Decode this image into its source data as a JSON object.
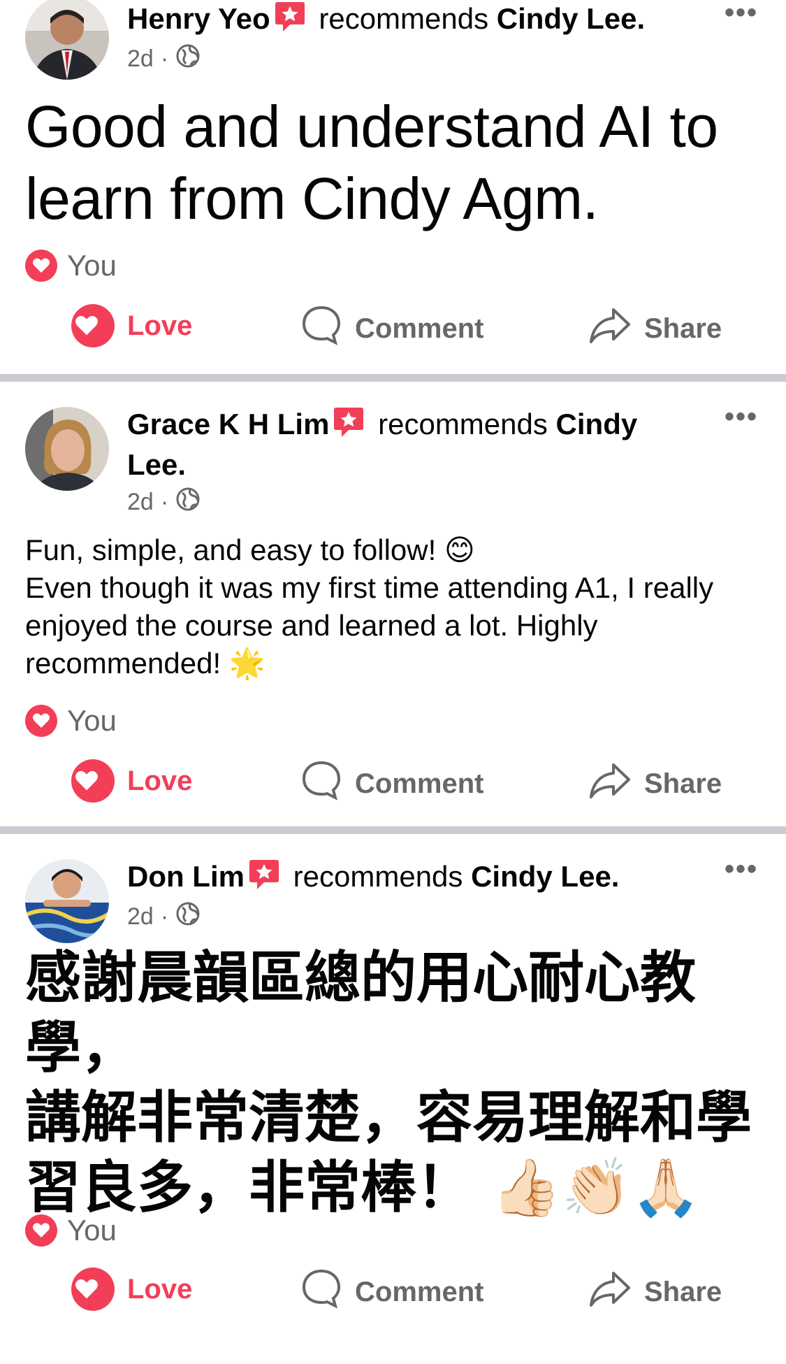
{
  "posts": [
    {
      "author": "Henry Yeo",
      "recommends": "recommends",
      "target": "Cindy Lee.",
      "time": "2d",
      "text": "Good and understand AI to learn from Cindy Agm.",
      "reaction_name": "You",
      "actions": {
        "love": "Love",
        "comment": "Comment",
        "share": "Share"
      }
    },
    {
      "author": "Grace K H Lim",
      "recommends": "recommends",
      "target": "Cindy",
      "target2": "Lee.",
      "time": "2d",
      "text_line1": "Fun, simple, and easy to follow! 😊",
      "text_line2": "Even though it was my first time attending A1, I really enjoyed the course and learned a lot. Highly recommended! 🌟",
      "reaction_name": "You",
      "actions": {
        "love": "Love",
        "comment": "Comment",
        "share": "Share"
      }
    },
    {
      "author": "Don Lim",
      "recommends": "recommends",
      "target": "Cindy Lee.",
      "time": "2d",
      "text_line1": "感謝晨韻區總的用心耐心教學，",
      "text_line2": "講解非常清楚，容易理解和學習良多，非常棒！ 👍🏻👏🏻🙏🏻",
      "reaction_name": "You",
      "actions": {
        "love": "Love",
        "comment": "Comment",
        "share": "Share"
      }
    }
  ],
  "colors": {
    "love": "#f33e58",
    "secondary": "#65676b",
    "divider": "#c9ccd1"
  },
  "icons": [
    "recommend-badge-icon",
    "globe-icon",
    "more-icon",
    "heart-icon",
    "comment-icon",
    "share-icon"
  ]
}
